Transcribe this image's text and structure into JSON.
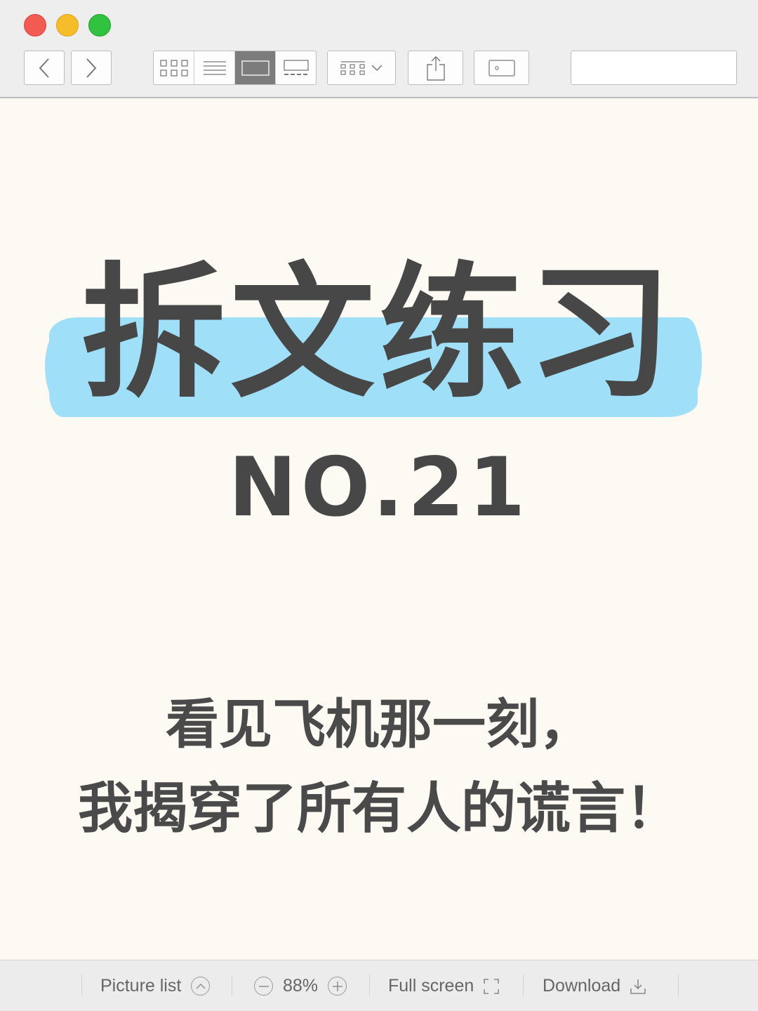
{
  "window": {
    "traffic_lights": {
      "close": "#f25a52",
      "minimize": "#f6bd2a",
      "zoom": "#31c23f"
    }
  },
  "toolbar": {
    "back_icon": "chevron-left-icon",
    "forward_icon": "chevron-right-icon",
    "view_modes": [
      {
        "icon": "icon-grid-icon",
        "active": false
      },
      {
        "icon": "list-view-icon",
        "active": true
      },
      {
        "icon": "single-image-icon",
        "active": false
      },
      {
        "icon": "filmstrip-icon",
        "active": false
      }
    ],
    "arrange_icon": "arrange-grid-icon",
    "share_icon": "share-icon",
    "slideshow_icon": "slideshow-icon",
    "search": {
      "value": "",
      "placeholder": ""
    }
  },
  "content": {
    "title": "拆文练习",
    "issue": "NO.21",
    "subtitle_line1": "看见飞机那一刻，",
    "subtitle_line2": "我揭穿了所有人的谎言！",
    "highlight_color": "#9fe0f8",
    "text_color": "#474747",
    "background_color": "#fdf9f3"
  },
  "bottombar": {
    "picture_list": "Picture list",
    "zoom": "88%",
    "full_screen": "Full screen",
    "download": "Download"
  }
}
